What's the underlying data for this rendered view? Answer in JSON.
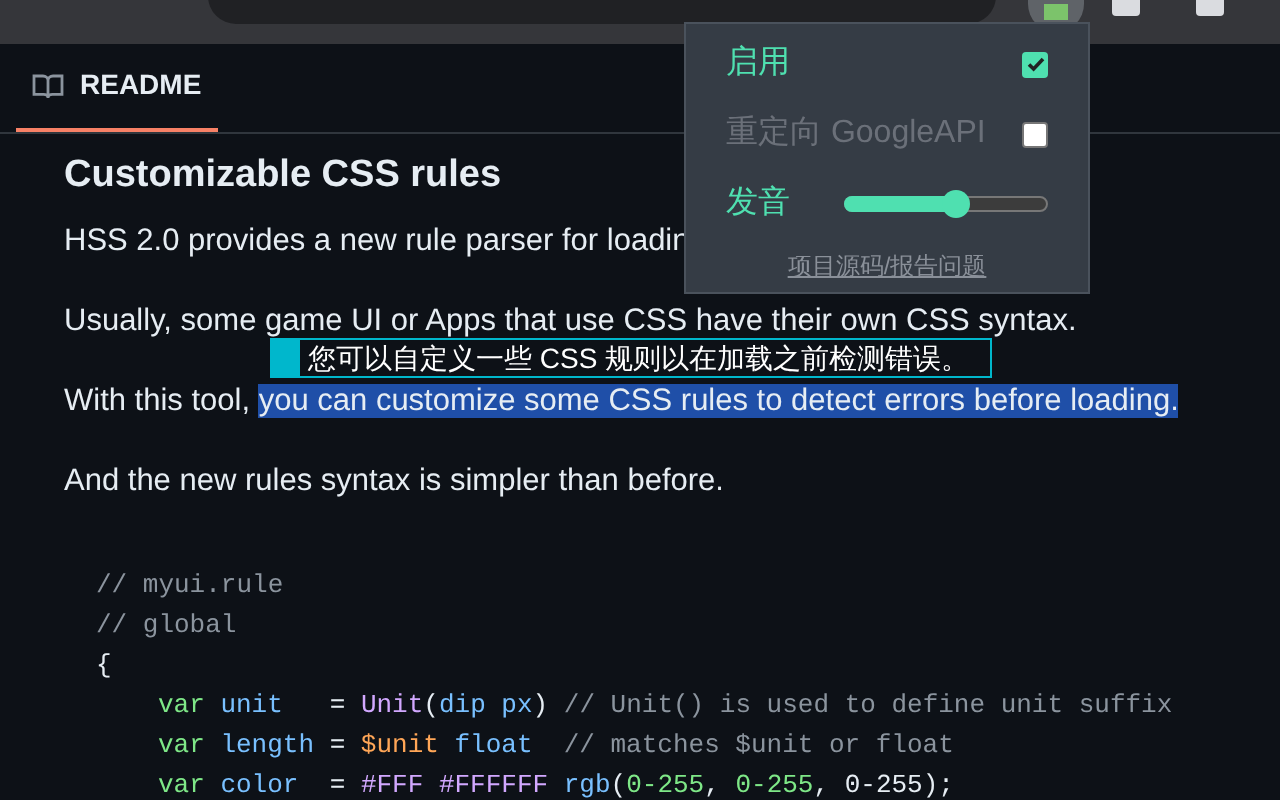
{
  "tab": {
    "label": "README",
    "selected": true
  },
  "heading": "Customizable CSS rules",
  "paragraphs": [
    [
      {
        "text": "HSS 2.0 provides a new rule parser for loadin",
        "selected": false
      }
    ],
    [
      {
        "text": "Usually, some game UI or Apps that use CSS have their own CSS syntax.",
        "selected": false
      }
    ],
    [
      {
        "text": "With this tool, ",
        "selected": false
      },
      {
        "text": "you can customize some CSS rules to detect errors before loading.",
        "selected": true
      }
    ],
    [
      {
        "text": "And the new rules syntax is simpler than before.",
        "selected": false
      }
    ]
  ],
  "tooltip": "您可以自定义一些 CSS 规则以在加载之前检测错误。",
  "code_lines": [
    {
      "tokens": [
        {
          "kind": "comment",
          "text": "// myui.rule"
        }
      ]
    },
    {
      "tokens": [
        {
          "kind": "comment",
          "text": "// global"
        }
      ]
    },
    {
      "tokens": [
        {
          "kind": "plain",
          "text": "{"
        }
      ],
      "children": [
        {
          "tokens": [
            {
              "kind": "keyword",
              "text": "var"
            },
            {
              "kind": "name",
              "text": " unit"
            },
            {
              "kind": "plain",
              "text": "   = "
            },
            {
              "kind": "func",
              "text": "Unit"
            },
            {
              "kind": "plain",
              "text": "("
            },
            {
              "kind": "name",
              "text": "dip px"
            },
            {
              "kind": "plain",
              "text": ")"
            },
            {
              "kind": "comment",
              "text": " // Unit() is used to define unit suffix"
            }
          ]
        },
        {
          "tokens": [
            {
              "kind": "keyword",
              "text": "var"
            },
            {
              "kind": "name",
              "text": " length"
            },
            {
              "kind": "plain",
              "text": " = "
            },
            {
              "kind": "variable",
              "text": "$unit"
            },
            {
              "kind": "name",
              "text": " float"
            },
            {
              "kind": "comment",
              "text": "  // matches $unit or float"
            }
          ]
        },
        {
          "tokens": [
            {
              "kind": "keyword",
              "text": "var"
            },
            {
              "kind": "name",
              "text": " color"
            },
            {
              "kind": "plain",
              "text": "  = "
            },
            {
              "kind": "hex",
              "text": "#FFF #FFFFFF"
            },
            {
              "kind": "name",
              "text": " rgb"
            },
            {
              "kind": "plain",
              "text": "("
            },
            {
              "kind": "number",
              "text": "0-255"
            },
            {
              "kind": "plain",
              "text": ", "
            },
            {
              "kind": "number",
              "text": "0-255"
            },
            {
              "kind": "plain",
              "text": ", 0-255);"
            }
          ]
        }
      ]
    }
  ],
  "popup": {
    "items": [
      {
        "kind": "checkbox",
        "label": "启用",
        "checked": true,
        "disabled": false
      },
      {
        "kind": "checkbox",
        "label": "重定向 GoogleAPI",
        "checked": false,
        "disabled": true
      },
      {
        "kind": "slider",
        "label": "发音",
        "level": 0.55
      }
    ],
    "link": "项目源码/报告问题"
  }
}
